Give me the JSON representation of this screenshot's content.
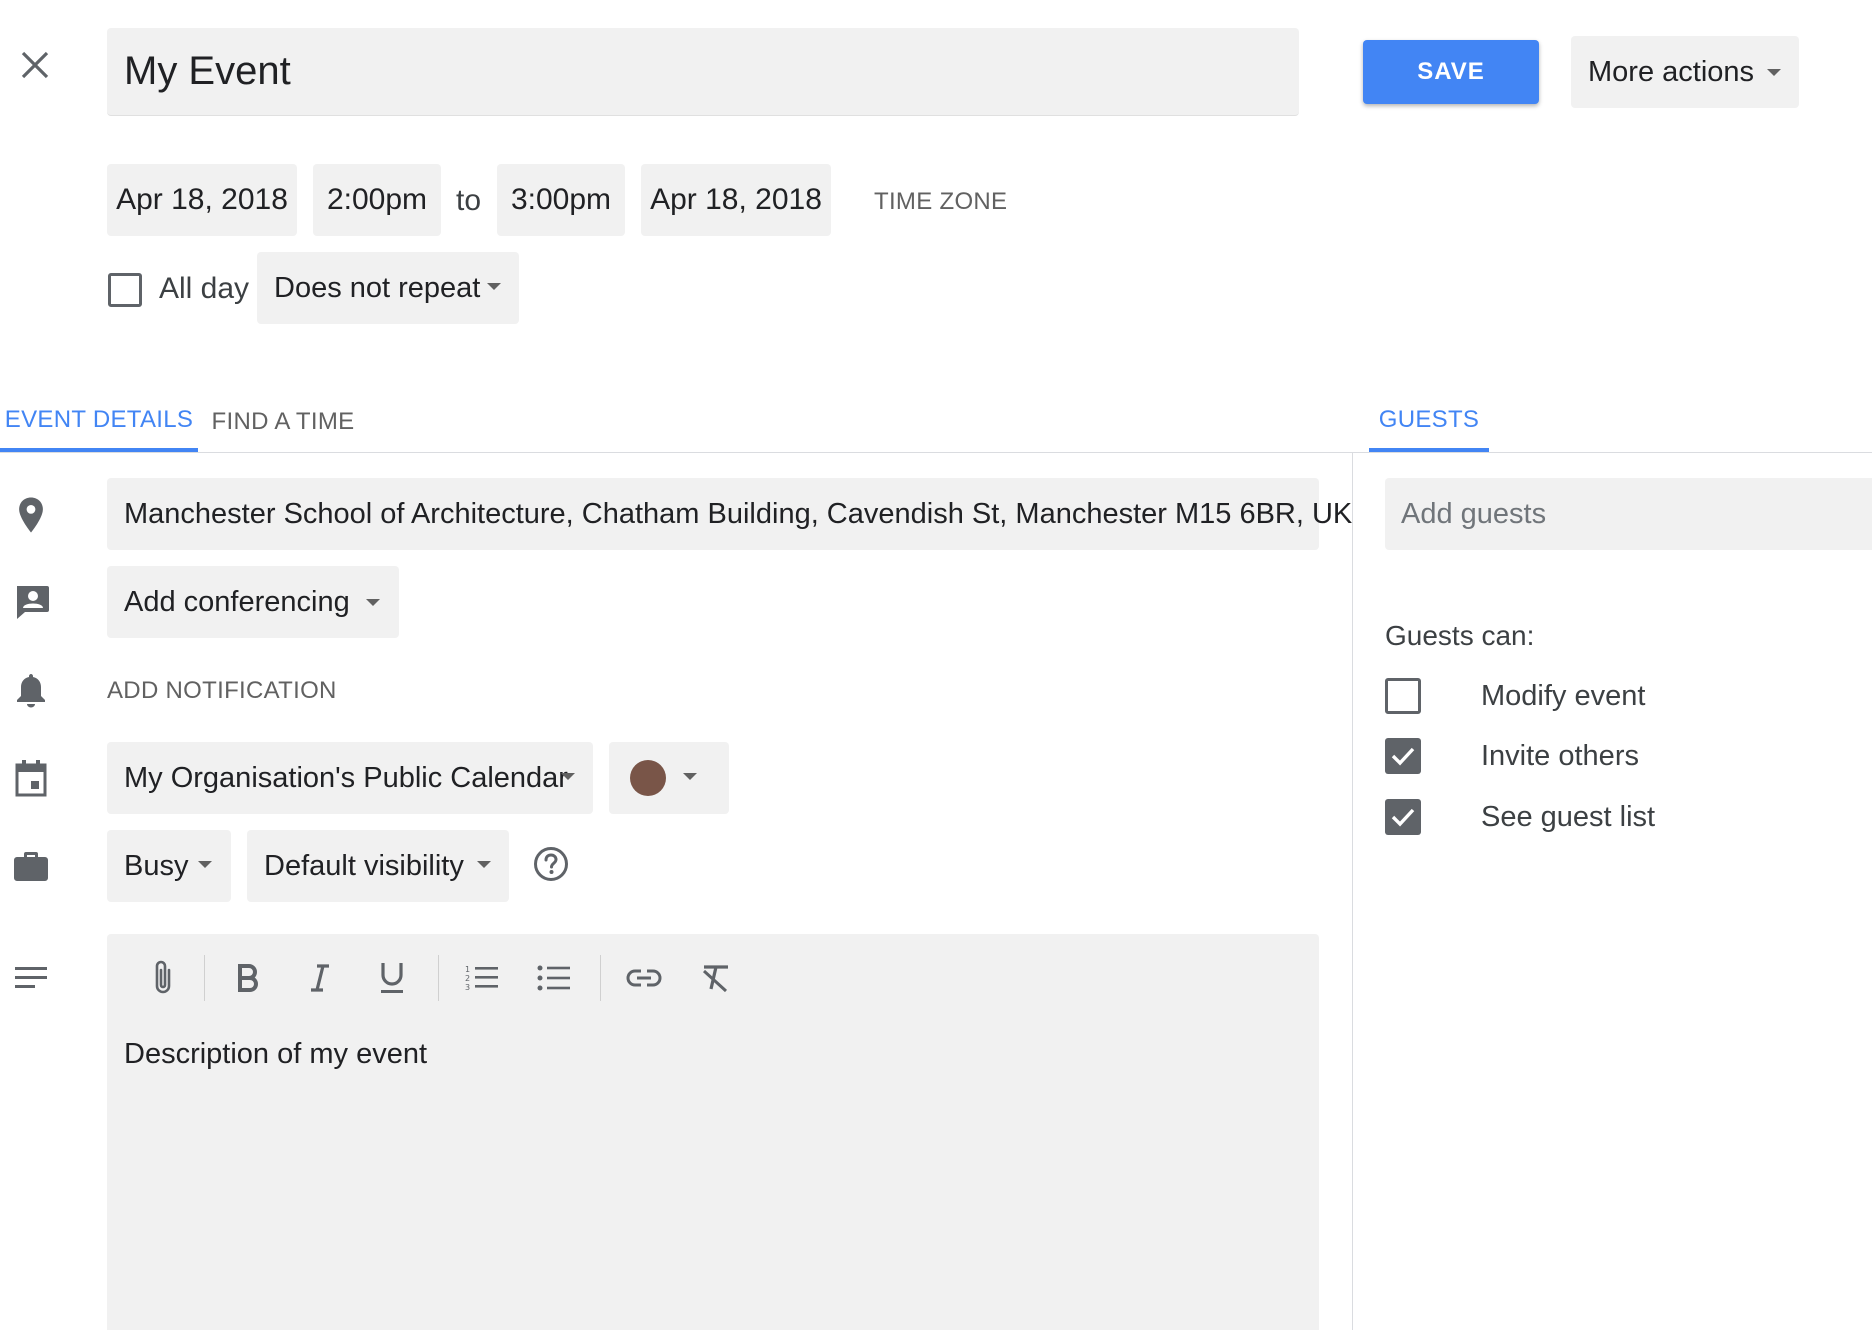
{
  "header": {
    "title_value": "My Event",
    "save_label": "SAVE",
    "more_actions_label": "More actions"
  },
  "datetime": {
    "start_date": "Apr 18, 2018",
    "start_time": "2:00pm",
    "to_label": "to",
    "end_time": "3:00pm",
    "end_date": "Apr 18, 2018",
    "timezone_label": "TIME ZONE",
    "all_day_label": "All day",
    "all_day_checked": false,
    "repeat_value": "Does not repeat"
  },
  "tabs": {
    "event_details": "EVENT DETAILS",
    "find_a_time": "FIND A TIME",
    "guests": "GUESTS",
    "active": "event_details"
  },
  "details": {
    "location_value": "Manchester School of Architecture, Chatham Building, Cavendish St, Manchester M15 6BR, UK",
    "conferencing_label": "Add conferencing",
    "notification_label": "ADD NOTIFICATION",
    "calendar_value": "My Organisation's Public Calendar",
    "event_color": "#795548",
    "availability_value": "Busy",
    "visibility_value": "Default visibility",
    "description_value": "Description of my event"
  },
  "guests": {
    "add_guests_placeholder": "Add guests",
    "guests_can_label": "Guests can:",
    "permissions": [
      {
        "label": "Modify event",
        "checked": false
      },
      {
        "label": "Invite others",
        "checked": true
      },
      {
        "label": "See guest list",
        "checked": true
      }
    ]
  },
  "colors": {
    "accent": "#4285f4",
    "field_bg": "#f1f1f1",
    "icon_gray": "#5f6368"
  }
}
